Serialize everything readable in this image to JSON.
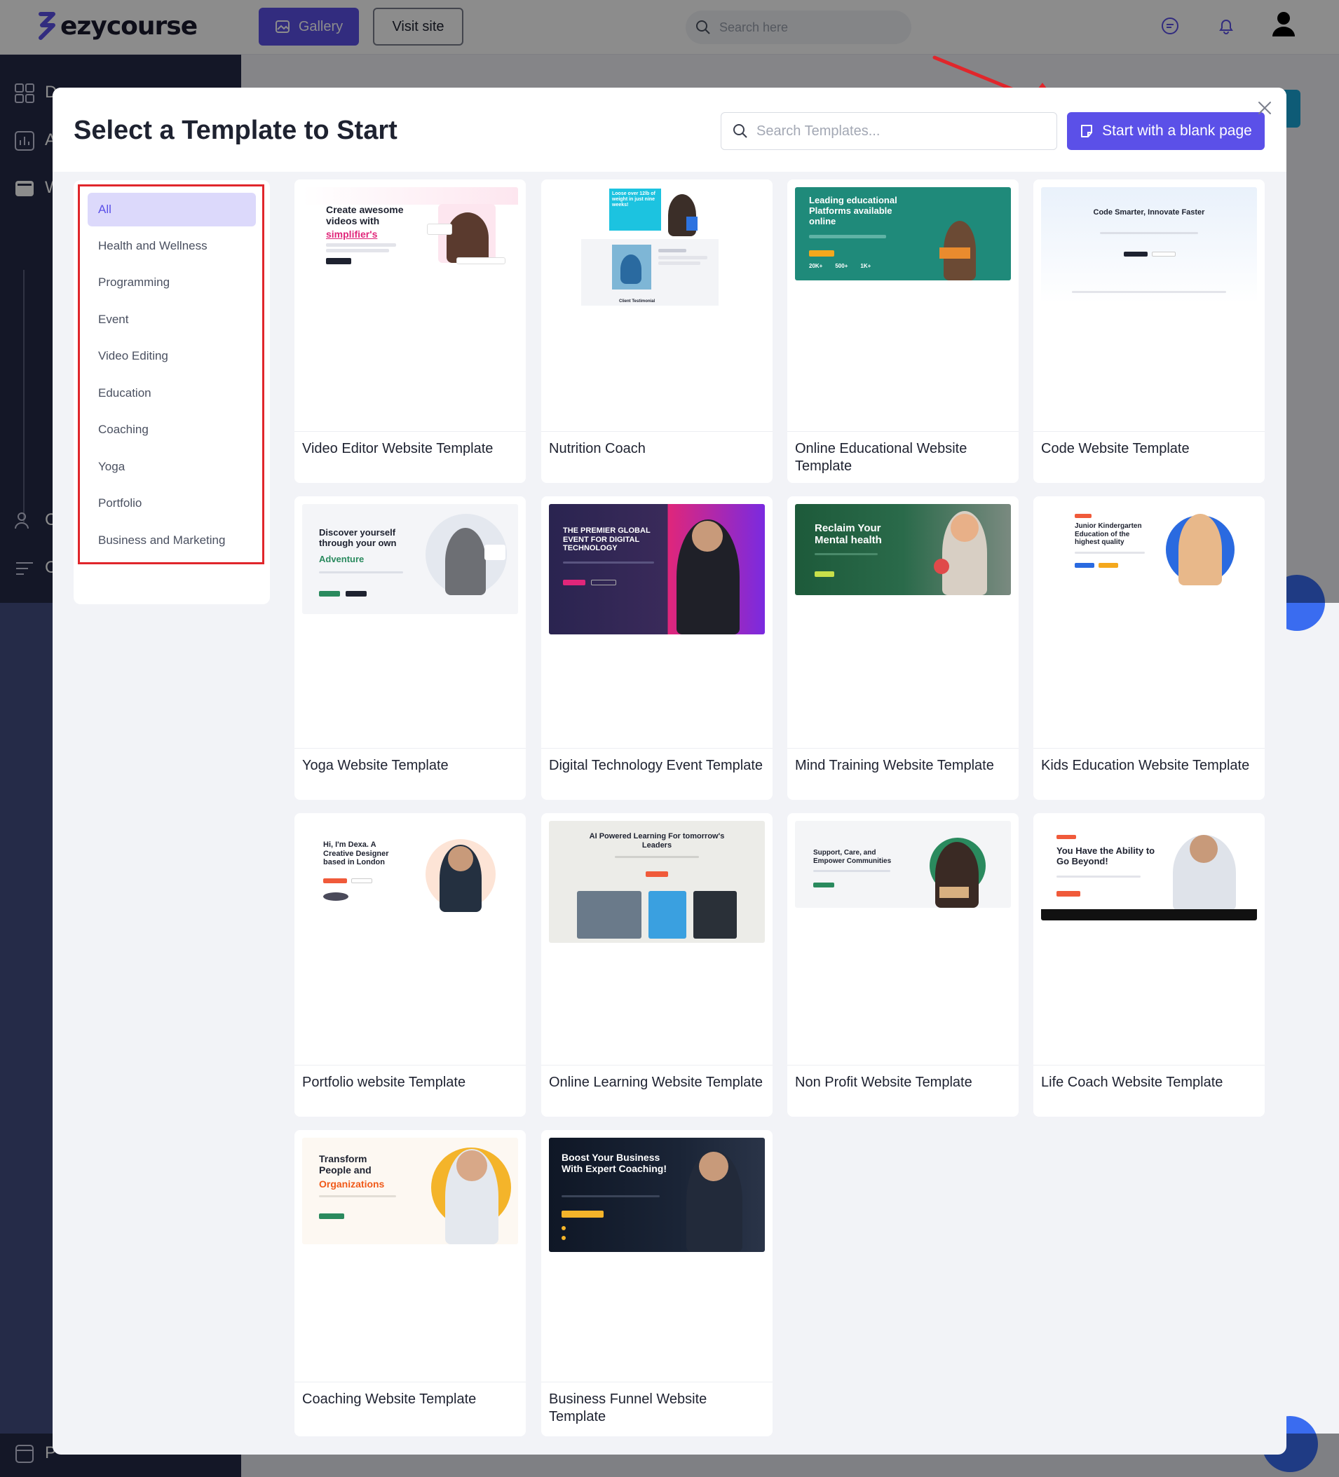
{
  "app": {
    "brand": "ezycourse",
    "gallery_label": "Gallery",
    "visit_label": "Visit site",
    "search_placeholder": "Search here",
    "icons": {
      "chat": "chat-icon",
      "bell": "bell-icon",
      "user": "user-avatar-icon"
    }
  },
  "sidebar": {
    "items": [
      {
        "icon": "dashboard-icon",
        "label": "D"
      },
      {
        "icon": "analytics-icon",
        "label": "A"
      },
      {
        "icon": "website-icon",
        "label": "W"
      },
      {
        "icon": "users-icon",
        "label": "C"
      },
      {
        "icon": "filter-icon",
        "label": "C"
      },
      {
        "icon": "page-icon",
        "label": "P"
      }
    ]
  },
  "modal": {
    "title": "Select a Template to Start",
    "search_placeholder": "Search Templates...",
    "blank_button_label": "Start with a blank page",
    "categories": [
      {
        "label": "All",
        "active": true
      },
      {
        "label": "Health and Wellness"
      },
      {
        "label": "Programming"
      },
      {
        "label": "Event"
      },
      {
        "label": "Video Editing"
      },
      {
        "label": "Education"
      },
      {
        "label": "Coaching"
      },
      {
        "label": "Yoga"
      },
      {
        "label": "Portfolio"
      },
      {
        "label": "Business and Marketing"
      }
    ],
    "templates": [
      {
        "title": "Video Editor Website Template",
        "thumb_heading": "Create awesome videos with",
        "thumb_accent": "simplifier's"
      },
      {
        "title": "Nutrition Coach",
        "thumb_heading": "Loose over 12lb of weight in just nine weeks!",
        "thumb_sub": "Client Testimonial"
      },
      {
        "title": "Online Educational Website Template",
        "thumb_heading": "Leading educational Platforms available online",
        "thumb_stats": [
          "20K+",
          "500+",
          "1K+"
        ]
      },
      {
        "title": "Code Website Template",
        "thumb_heading": "Code Smarter, Innovate Faster"
      },
      {
        "title": "Yoga Website Template",
        "thumb_heading": "Discover yourself through your own",
        "thumb_accent": "Adventure"
      },
      {
        "title": "Digital Technology Event Template",
        "thumb_heading": "THE PREMIER GLOBAL EVENT FOR DIGITAL TECHNOLOGY"
      },
      {
        "title": "Mind Training Website Template",
        "thumb_heading": "Reclaim Your Mental health"
      },
      {
        "title": "Kids Education Website Template",
        "thumb_heading": "Junior Kindergarten Education of the highest quality"
      },
      {
        "title": "Portfolio website Template",
        "thumb_heading": "Hi, I'm Dexa. A Creative Designer based in London"
      },
      {
        "title": "Online Learning Website Template",
        "thumb_heading": "AI Powered Learning For tomorrow's Leaders"
      },
      {
        "title": "Non Profit Website Template",
        "thumb_heading": "Support, Care, and Empower Communities"
      },
      {
        "title": "Life Coach Website Template",
        "thumb_heading": "You Have the Ability to Go Beyond!"
      },
      {
        "title": "Coaching Website Template",
        "thumb_heading": "Transform People and",
        "thumb_accent": "Organizations"
      },
      {
        "title": "Business Funnel Website Template",
        "thumb_heading": "Boost Your Business With Expert Coaching!"
      }
    ]
  },
  "colors": {
    "primary": "#5b50e8",
    "sidebar_bg": "#252b48",
    "highlight_red": "#e0262b",
    "active_category_bg": "#dcd9fb"
  }
}
